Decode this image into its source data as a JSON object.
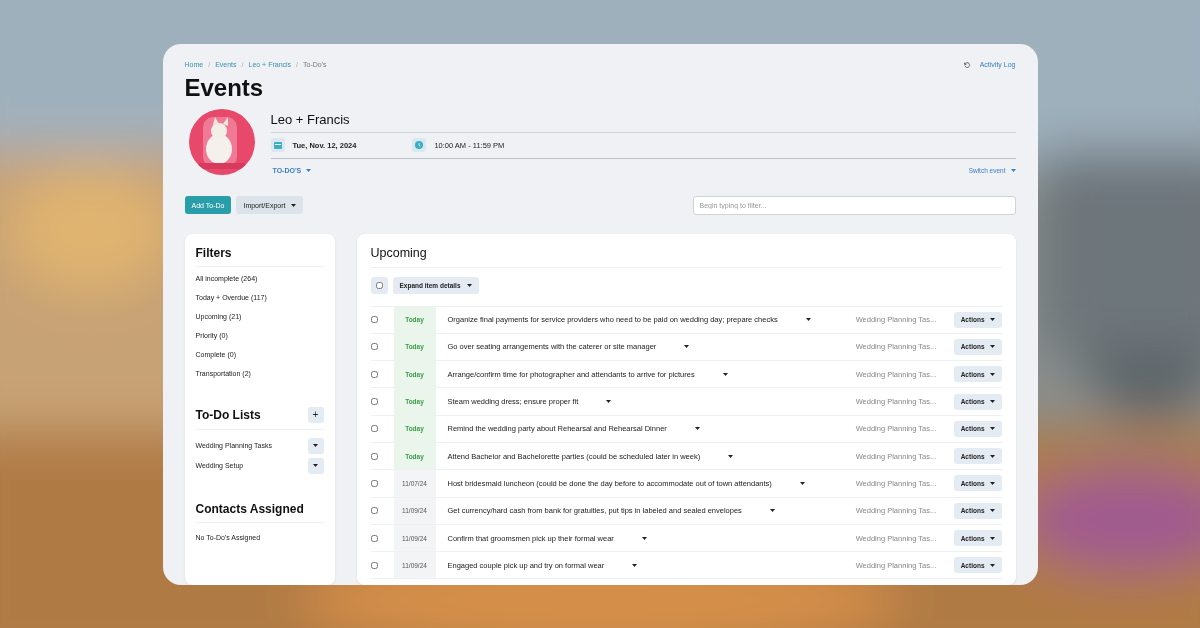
{
  "breadcrumbs": [
    "Home",
    "Events",
    "Leo + Francis",
    "To-Do's"
  ],
  "breadcrumb_separator": "/",
  "activity_log": "Activity Log",
  "page_title": "Events",
  "event": {
    "name": "Leo + Francis",
    "date": "Tue, Nov. 12, 2024",
    "time": "10:00 AM - 11:59 PM",
    "view_menu": "TO-DO'S",
    "switch_event": "Switch event"
  },
  "toolbar": {
    "add_button": "Add To-Do",
    "import_button": "Import/Export",
    "filter": {
      "placeholder": "Begin typing to filter..."
    }
  },
  "sidebar": {
    "filters_title": "Filters",
    "filters": [
      {
        "label": "All incomplete (264)"
      },
      {
        "label": "Today + Overdue (117)"
      },
      {
        "label": "Upcoming (21)"
      },
      {
        "label": "Priority (0)"
      },
      {
        "label": "Complete (0)"
      },
      {
        "label": "Transportation (2)"
      }
    ],
    "lists_title": "To-Do Lists",
    "add_list": "+",
    "lists": [
      "Wedding Planning Tasks",
      "Wedding Setup"
    ],
    "contacts_title": "Contacts Assigned",
    "contacts_empty": "No To-Do's Assigned"
  },
  "main": {
    "title": "Upcoming",
    "select_all_checked": false,
    "expand_button": "Expand item details",
    "rows": [
      {
        "checked": false,
        "date": "Today",
        "today": true,
        "task": "Organize final payments for service providers who need to be paid on wedding day; prepare checks",
        "list": "Wedding Planning Tas...",
        "actions": "Actions"
      },
      {
        "checked": false,
        "date": "Today",
        "today": true,
        "task": "Go over seating arrangements with the caterer or site manager",
        "list": "Wedding Planning Tas...",
        "actions": "Actions"
      },
      {
        "checked": false,
        "date": "Today",
        "today": true,
        "task": "Arrange/confirm time for photographer and attendants to arrive for pictures",
        "list": "Wedding Planning Tas...",
        "actions": "Actions"
      },
      {
        "checked": false,
        "date": "Today",
        "today": true,
        "task": "Steam wedding dress; ensure proper fit",
        "list": "Wedding Planning Tas...",
        "actions": "Actions"
      },
      {
        "checked": false,
        "date": "Today",
        "today": true,
        "task": "Remind the wedding party about Rehearsal and Rehearsal Dinner",
        "list": "Wedding Planning Tas...",
        "actions": "Actions"
      },
      {
        "checked": false,
        "date": "Today",
        "today": true,
        "task": "Attend Bachelor and Bachelorette parties (could be scheduled later in week)",
        "list": "Wedding Planning Tas...",
        "actions": "Actions"
      },
      {
        "checked": false,
        "date": "11/07/24",
        "today": false,
        "task": "Host bridesmaid luncheon (could be done the day before to accommodate out of town attendants)",
        "list": "Wedding Planning Tas...",
        "actions": "Actions"
      },
      {
        "checked": false,
        "date": "11/09/24",
        "today": false,
        "task": "Get currency/hard cash from bank for gratuities, put tips in labeled and sealed envelopes",
        "list": "Wedding Planning Tas...",
        "actions": "Actions"
      },
      {
        "checked": false,
        "date": "11/09/24",
        "today": false,
        "task": "Confirm that groomsmen pick up their formal wear",
        "list": "Wedding Planning Tas...",
        "actions": "Actions"
      },
      {
        "checked": false,
        "date": "11/09/24",
        "today": false,
        "task": "Engaged couple pick up and try on formal wear",
        "list": "Wedding Planning Tas...",
        "actions": "Actions"
      }
    ]
  }
}
